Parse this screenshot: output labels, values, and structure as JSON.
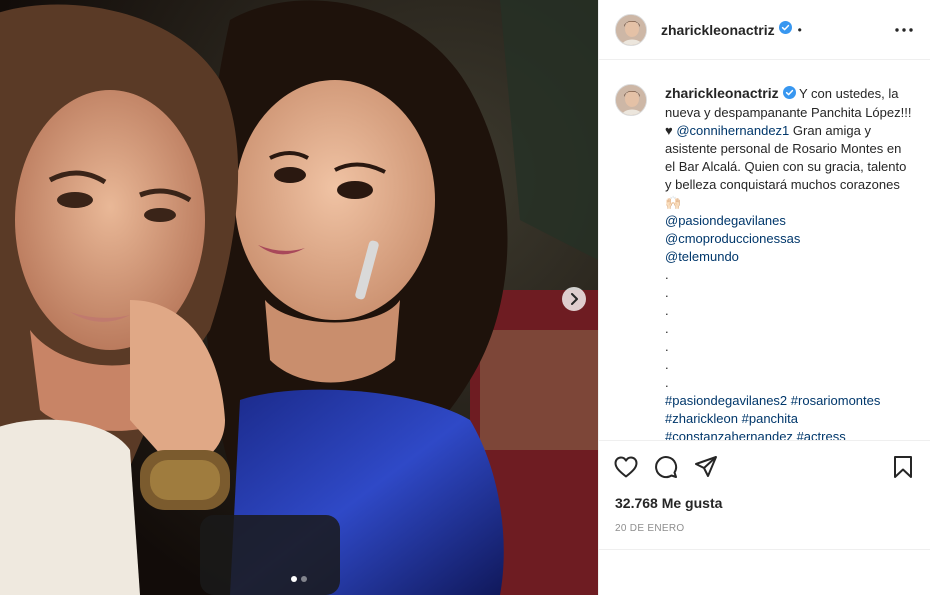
{
  "post": {
    "username": "zharickleonactriz",
    "verified": true,
    "separator": "•"
  },
  "caption": {
    "username": "zharickleonactriz",
    "text_1": " Y con ustedes, la nueva y despampanante Panchita López!!!♥ ",
    "mention_1": "@connihernandez1",
    "text_2": " Gran amiga y asistente personal de Rosario Montes en el Bar Alcalá. Quien con su gracia, talento y belleza conquistará muchos corazones 🙌🏻",
    "mentions": [
      "@pasiondegavilanes",
      "@cmoproduccionessas",
      "@telemundo"
    ],
    "dots": [
      ".",
      ".",
      ".",
      ".",
      ".",
      ".",
      "."
    ],
    "hashtags_line_1": [
      "#pasiondegavilanes2",
      "#rosariomontes"
    ],
    "hashtags_line_2": [
      "#zharickleon",
      "#panchita"
    ],
    "hashtags_line_3": [
      "#constanzahernandez",
      "#actress"
    ]
  },
  "media": {
    "carousel_dots": 2,
    "active_dot": 0
  },
  "icons": {
    "like": "heart-icon",
    "comment": "comment-icon",
    "share": "paper-plane-icon",
    "save": "bookmark-icon",
    "next": "chevron-right-icon",
    "more": "more-options-icon"
  },
  "stats": {
    "likes": "32.768 Me gusta",
    "date": "20 DE ENERO"
  },
  "comment": {
    "placeholder": ""
  },
  "colors": {
    "verified": "#3897f0",
    "link": "#00376b",
    "muted": "#8e8e8e"
  }
}
